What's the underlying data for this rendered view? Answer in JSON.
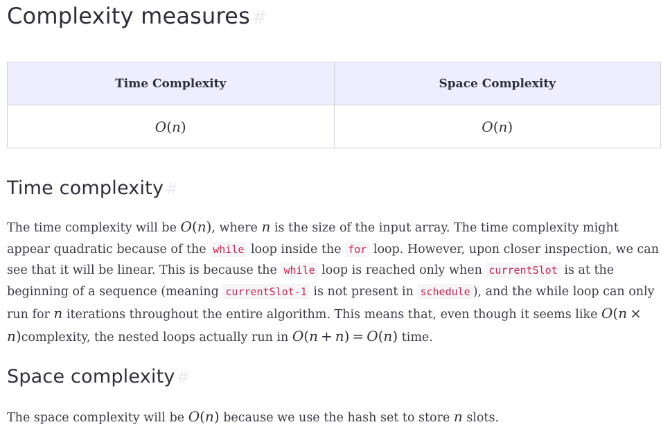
{
  "title": "Complexity measures",
  "anchor_symbol": "#",
  "table": {
    "headers": [
      "Time Complexity",
      "Space Complexity"
    ],
    "row": [
      "O(n)",
      "O(n)"
    ]
  },
  "time_section": {
    "heading": "Time complexity",
    "paragraph": [
      {
        "t": "The time complexity will be "
      },
      {
        "m": "O(n)"
      },
      {
        "t": ", where "
      },
      {
        "m": "n"
      },
      {
        "t": " is the size of the input array. The time complexity might appear quadratic because of the "
      },
      {
        "c": "while"
      },
      {
        "t": " loop inside the "
      },
      {
        "c": "for"
      },
      {
        "t": " loop. However, upon closer inspection, we can see that it will be linear. This is because the "
      },
      {
        "c": "while"
      },
      {
        "t": " loop is reached only when "
      },
      {
        "c": "currentSlot"
      },
      {
        "t": " is at the beginning of a sequence (meaning "
      },
      {
        "c": "currentSlot-1"
      },
      {
        "t": " is not present in "
      },
      {
        "c": "schedule"
      },
      {
        "t": "), and the while loop can only run for "
      },
      {
        "m": "n"
      },
      {
        "t": " iterations throughout the entire algorithm. This means that, even though it seems like "
      },
      {
        "m": "O(n × n)"
      },
      {
        "t": "complexity, the nested loops actually run in "
      },
      {
        "m": "O(n + n) = O(n)"
      },
      {
        "t": " time."
      }
    ]
  },
  "space_section": {
    "heading": "Space complexity",
    "paragraph": [
      {
        "t": "The space complexity will be "
      },
      {
        "m": "O(n)"
      },
      {
        "t": " because we use the hash set to store "
      },
      {
        "m": "n"
      },
      {
        "t": " slots."
      }
    ]
  }
}
